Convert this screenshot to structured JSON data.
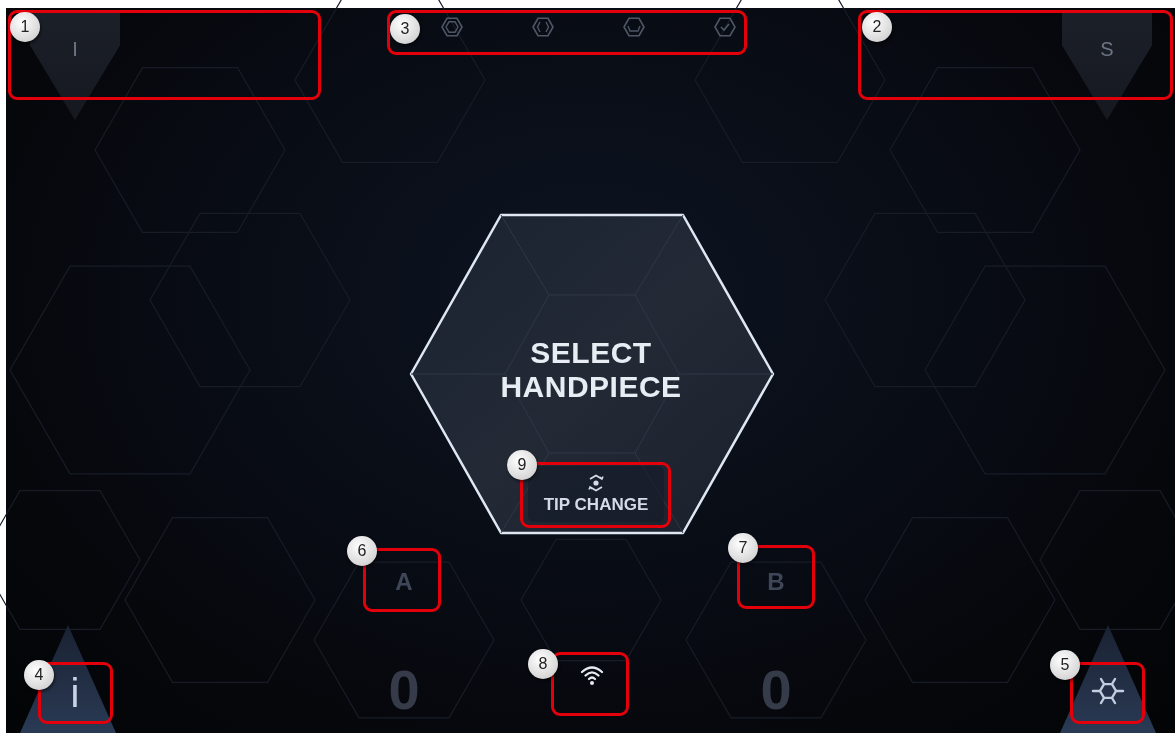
{
  "top_left_tab": {
    "label": "I",
    "callout": "1"
  },
  "top_right_tab": {
    "label": "S",
    "callout": "2"
  },
  "steps": {
    "callout": "3",
    "items": [
      {
        "kind": "ring"
      },
      {
        "kind": "brackets"
      },
      {
        "kind": "cup"
      },
      {
        "kind": "check"
      }
    ]
  },
  "center": {
    "title": "SELECT HANDPIECE",
    "tip_change": {
      "label": "TIP CHANGE",
      "callout": "9"
    }
  },
  "channels": [
    {
      "label": "A",
      "count": "0",
      "callout": "6"
    },
    {
      "label": "B",
      "count": "0",
      "callout": "7"
    }
  ],
  "info_button": {
    "label": "i",
    "callout": "4"
  },
  "wifi": {
    "callout": "8"
  },
  "settings_button": {
    "callout": "5"
  }
}
